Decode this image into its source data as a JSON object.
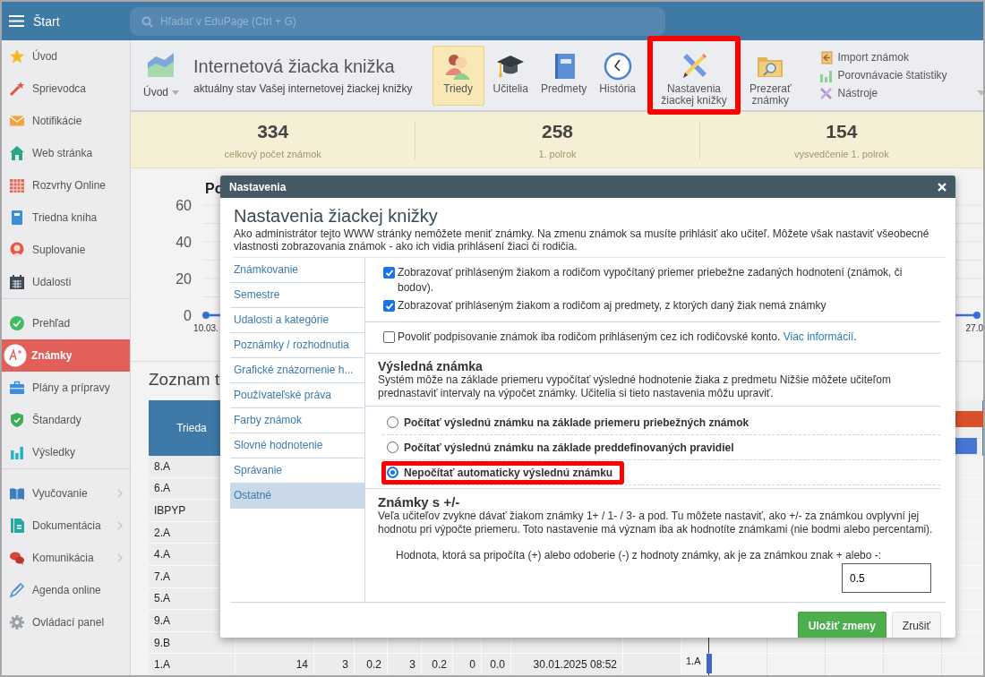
{
  "top_bar": {
    "title": "Štart",
    "search": {
      "placeholder": "Hľadať v EduPage (Ctrl + G)"
    }
  },
  "sidebar": {
    "sections": [
      {
        "items": [
          {
            "label": "Úvod",
            "selected": false
          },
          {
            "label": "Sprievodca",
            "selected": false
          },
          {
            "label": "Notifikácie",
            "selected": false
          },
          {
            "label": "Web stránka",
            "selected": false
          },
          {
            "label": "Rozvrhy Online",
            "selected": false
          },
          {
            "label": "Triedna kniha",
            "selected": false
          },
          {
            "label": "Suplovanie",
            "selected": false
          },
          {
            "label": "Udalosti",
            "selected": false
          }
        ]
      },
      {
        "items": [
          {
            "label": "Prehľad",
            "selected": false
          },
          {
            "label": "Známky",
            "selected": true
          },
          {
            "label": "Plány a prípravy",
            "selected": false
          },
          {
            "label": "Štandardy",
            "selected": false
          },
          {
            "label": "Výsledky",
            "selected": false
          }
        ]
      },
      {
        "items": [
          {
            "label": "Vyučovanie",
            "selected": false,
            "has_submenu": true
          },
          {
            "label": "Dokumentácia",
            "selected": false,
            "has_submenu": true
          },
          {
            "label": "Komunikácia",
            "selected": false,
            "has_submenu": true
          },
          {
            "label": "Agenda online",
            "selected": false,
            "has_submenu": false
          },
          {
            "label": "Ovládací panel",
            "selected": false,
            "has_submenu": false
          }
        ]
      }
    ]
  },
  "toolbar": {
    "home": {
      "label": "Úvod"
    },
    "title": "Internetová žiacka knižka",
    "subtitle": "aktuálny stav Vašej internetovej žiackej knižky",
    "buttons": [
      {
        "label": "Triedy",
        "selected": true,
        "highlighted": false
      },
      {
        "label": "Učitelia",
        "selected": false,
        "highlighted": false
      },
      {
        "label": "Predmety",
        "selected": false,
        "highlighted": false
      },
      {
        "label": "História",
        "selected": false,
        "highlighted": false
      },
      {
        "label": "Nastavenia žiackej knižky",
        "selected": false,
        "highlighted": true
      },
      {
        "label": "Prezerať známky",
        "selected": false,
        "highlighted": false
      }
    ],
    "links": [
      {
        "label": "Import známok",
        "has_dropdown": false
      },
      {
        "label": "Porovnávacie štatistiky",
        "has_dropdown": false
      },
      {
        "label": "Nástroje",
        "has_dropdown": true
      }
    ]
  },
  "stats": [
    {
      "value": "334",
      "label": "celkový počet známok"
    },
    {
      "value": "258",
      "label": "1. polrok"
    },
    {
      "value": "154",
      "label": "vysvedčenie 1. polrok"
    }
  ],
  "chart": {
    "title": "Po",
    "y_labels": [
      "60",
      "40",
      "20",
      "0"
    ],
    "x_labels": [
      "10.03.",
      "27.0"
    ]
  },
  "list": {
    "heading": "Zoznam t",
    "table": {
      "columns": [
        "Trieda"
      ],
      "rows": [
        {
          "cells": [
            "8.A"
          ]
        },
        {
          "cells": [
            "6.A"
          ]
        },
        {
          "cells": [
            "IBPYP"
          ]
        },
        {
          "cells": [
            "2.A"
          ]
        },
        {
          "cells": [
            "4.A"
          ]
        },
        {
          "cells": [
            "7.A"
          ]
        },
        {
          "cells": [
            "5.A"
          ]
        },
        {
          "cells": [
            "9.A"
          ]
        },
        {
          "cells": [
            "9.B"
          ]
        },
        {
          "cells": [
            "1.A",
            "14",
            "3",
            "0.2",
            "3",
            "0.2",
            "0",
            "0.0",
            "30.01.2025 08:52"
          ],
          "chart_label": "1.A"
        }
      ]
    }
  },
  "dialog": {
    "title": "Nastavenia",
    "heading": "Nastavenia žiackej knižky",
    "description": "Ako administrátor tejto WWW stránky nemôžete meniť známky. Na zmenu známok sa musíte prihlásiť ako učiteľ. Môžete však nastaviť všeobecné vlastnosti zobrazovania známok - ako ich vidia prihlásení žiaci či rodičia.",
    "nav": [
      {
        "label": "Známkovanie",
        "selected": false
      },
      {
        "label": "Semestre",
        "selected": false
      },
      {
        "label": "Udalosti a kategórie",
        "selected": false
      },
      {
        "label": "Poznámky / rozhodnutia",
        "selected": false
      },
      {
        "label": "Grafické znázornenie h...",
        "selected": false
      },
      {
        "label": "Používateľské práva",
        "selected": false
      },
      {
        "label": "Farby známok",
        "selected": false
      },
      {
        "label": "Slovné hodnotenie",
        "selected": false
      },
      {
        "label": "Správanie",
        "selected": false
      },
      {
        "label": "Ostatné",
        "selected": true
      }
    ],
    "checkbox_groups": [
      [
        {
          "text": "Zobrazovať prihláseným žiakom a rodičom vypočítaný priemer priebežne zadaných hodnotení (známok, či bodov).",
          "checked": true
        },
        {
          "text": "Zobrazovať prihláseným žiakom a rodičom aj predmety, z ktorých daný žiak nemá známky",
          "checked": true
        }
      ],
      [
        {
          "text": "Povoliť podpisovanie známok iba rodičom prihláseným cez ich rodičovské konto.",
          "link": "Viac informácií",
          "after": ".",
          "checked": false
        }
      ]
    ],
    "final_grade": {
      "heading": "Výsledná známka",
      "description": "Systém môže na základe priemeru vypočítať výsledné hodnotenie žiaka z predmetu Nižšie môžete učiteľom prednastaviť intervaly na výpočet známky. Učitelia si tieto nastavenia môžu upraviť.",
      "options": [
        {
          "label": "Počítať výslednú známku na základe priemeru priebežných známok",
          "selected": false,
          "highlighted": false
        },
        {
          "label": "Počítať výslednú známku na základe preddefinovaných pravidiel",
          "selected": false,
          "highlighted": false
        },
        {
          "label": "Nepočítať automaticky výslednú známku",
          "selected": true,
          "highlighted": true
        }
      ]
    },
    "plus_minus": {
      "heading": "Známky s +/-",
      "description": "Veľa učiteľov zvykne dávať žiakom známky 1+ / 1- / 3- a pod. Tu môžete nastaviť, ako +/- za známkou ovplyvní jej hodnotu pri výpočte priemeru. Toto nastavenie má význam iba ak hodnotíte známkami (nie bodmi alebo percentami).",
      "field_label": "Hodnota, ktorá sa pripočíta (+) alebo odoberie (-) z hodnoty známky, ak je za známkou znak + alebo -:",
      "value": "0.5"
    },
    "buttons": [
      {
        "label": "Uložiť zmeny",
        "kind": "primary"
      },
      {
        "label": "Zrušiť",
        "kind": "secondary"
      }
    ]
  }
}
